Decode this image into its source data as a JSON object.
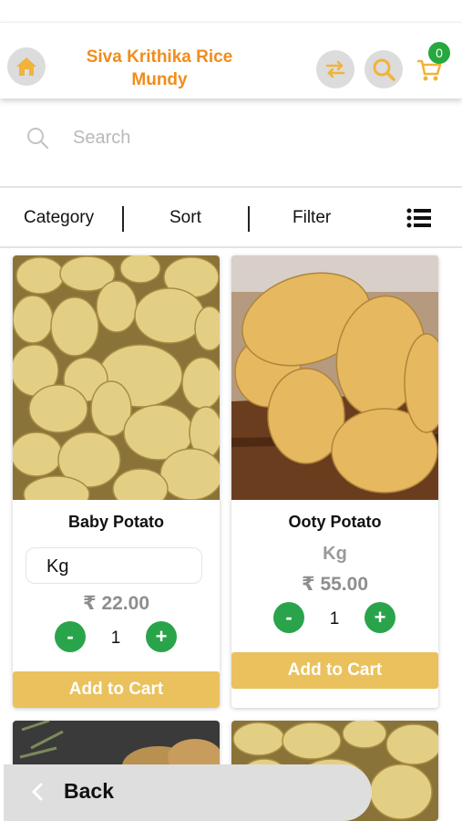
{
  "header": {
    "title": "Siva Krithika Rice Mundy",
    "cart_count": "0",
    "accent_color": "#f28c1a",
    "icons": [
      "home-icon",
      "swap-icon",
      "search-icon",
      "cart-icon"
    ]
  },
  "search": {
    "placeholder": "Search",
    "value": ""
  },
  "toolbar": {
    "category": "Category",
    "sort": "Sort",
    "filter": "Filter",
    "view_icon": "list-view-icon"
  },
  "products": [
    {
      "name": "Baby Potato",
      "unit": "Kg",
      "unit_style": "dropdown",
      "price": "₹ 22.00",
      "qty": "1",
      "minus": "-",
      "plus": "+",
      "add_label": "Add to Cart"
    },
    {
      "name": "Ooty Potato",
      "unit": "Kg",
      "unit_style": "text",
      "price": "₹ 55.00",
      "qty": "1",
      "minus": "-",
      "plus": "+",
      "add_label": "Add to Cart"
    }
  ],
  "footer": {
    "back_label": "Back"
  },
  "colors": {
    "qty_button": "#2aa44a",
    "add_to_cart": "#eac15c",
    "cart_badge": "#27a83e"
  }
}
